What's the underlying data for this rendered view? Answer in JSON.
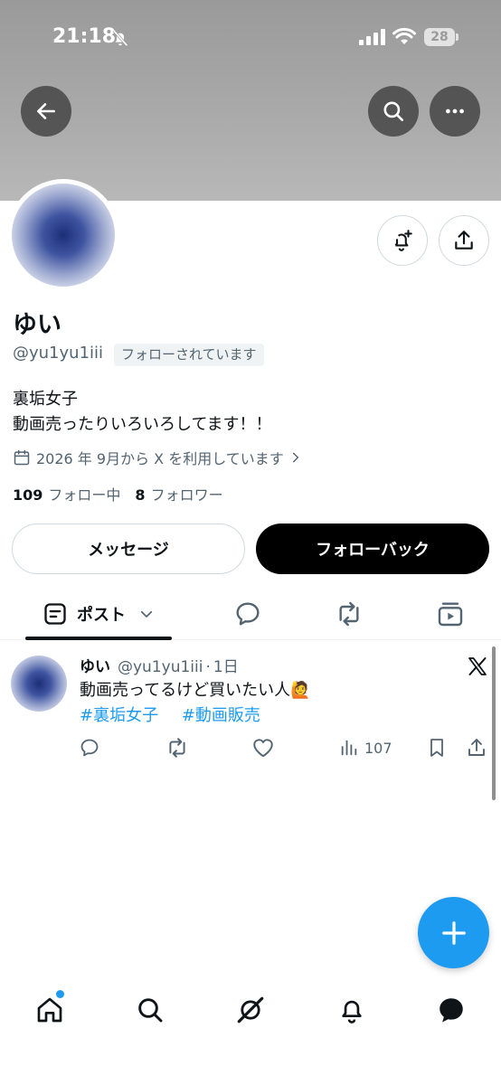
{
  "status_bar": {
    "time": "21:18",
    "battery": "28"
  },
  "profile": {
    "display_name": "ゆい",
    "handle": "@yu1yu1iii",
    "follows_you_badge": "フォローされています",
    "bio_line1": "裏垢女子",
    "bio_line2": "動画売ったりいろいろしてます！！",
    "joined": "2026 年 9月から X を利用しています",
    "following_count": "109",
    "following_label": "フォロー中",
    "followers_count": "8",
    "followers_label": "フォロワー"
  },
  "actions": {
    "message_label": "メッセージ",
    "followback_label": "フォローバック"
  },
  "tabs": {
    "posts_label": "ポスト"
  },
  "post": {
    "name": "ゆい",
    "handle": "@yu1yu1iii",
    "dot": "·",
    "time": "1日",
    "text": "動画売ってるけど買いたい人🙋",
    "tag1": "#裏垢女子",
    "tag2": "#動画販売",
    "views": "107"
  },
  "colors": {
    "accent": "#1d9bf0",
    "text": "#0f1419",
    "secondary_text": "#536471",
    "border": "#cfd9de"
  },
  "icons": [
    "back-arrow-icon",
    "search-icon",
    "more-icon",
    "bell-plus-icon",
    "share-icon",
    "calendar-icon",
    "chevron-right-icon",
    "post-tab-icon",
    "chevron-down-icon",
    "reply-icon",
    "repost-icon",
    "media-icon",
    "x-logo-icon",
    "like-icon",
    "views-icon",
    "bookmark-icon",
    "plus-icon",
    "home-icon",
    "grok-icon",
    "bell-icon",
    "messages-icon"
  ]
}
